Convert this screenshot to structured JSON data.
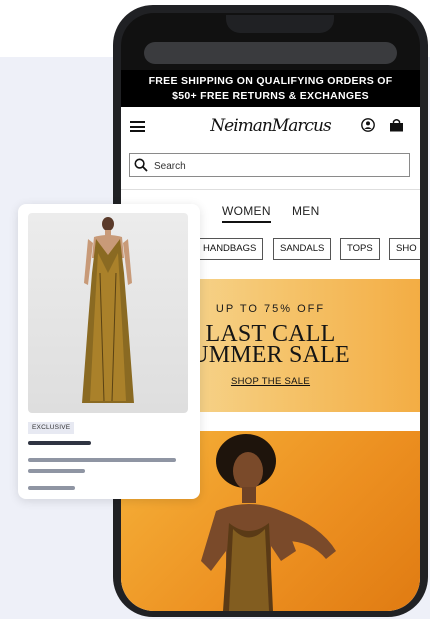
{
  "colors": {
    "accent": "#000000",
    "background": "#eef0f8",
    "banner": "#f5c36a",
    "hero": "#ec8f20"
  },
  "promo": {
    "line1": "FREE SHIPPING ON QUALIFYING ORDERS OF",
    "line2": "$50+ FREE RETURNS & EXCHANGES"
  },
  "header": {
    "logo": "NeimanMarcus",
    "menu_icon": "hamburger-icon",
    "account_icon": "account-icon",
    "bag_icon": "shopping-bag-icon"
  },
  "search": {
    "placeholder": "Search",
    "icon": "search-icon"
  },
  "tabs": [
    {
      "label": "WOMEN",
      "active": true
    },
    {
      "label": "MEN",
      "active": false
    }
  ],
  "categories": [
    "HANDBAGS",
    "SANDALS",
    "TOPS",
    "SHO"
  ],
  "banner": {
    "eyebrow": "UP TO 75% OFF",
    "headline_line1": "LAST CALL",
    "headline_line2": "UMMER SALE",
    "cta": "SHOP THE SALE"
  },
  "card": {
    "badge": "EXCLUSIVE"
  }
}
